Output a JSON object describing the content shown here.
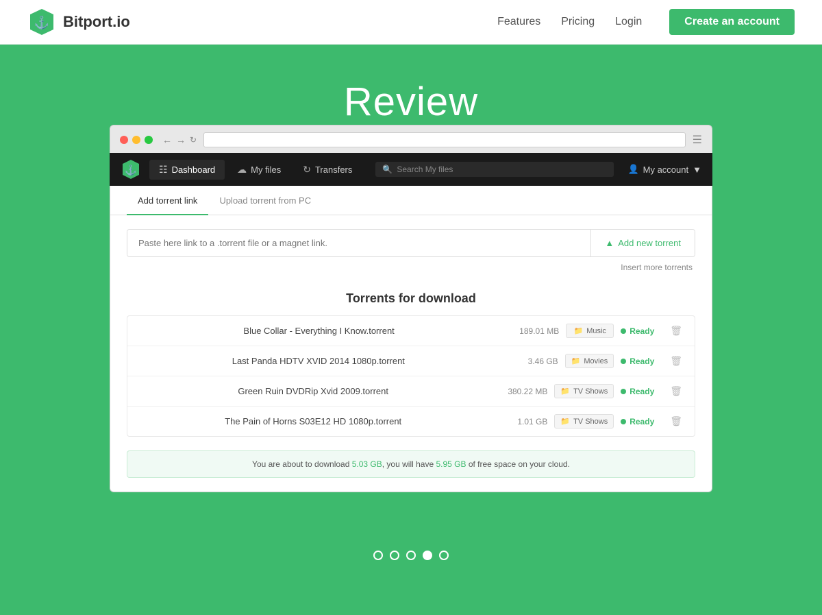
{
  "navbar": {
    "logo_text": "Bitport.io",
    "links": [
      {
        "id": "features",
        "label": "Features"
      },
      {
        "id": "pricing",
        "label": "Pricing"
      },
      {
        "id": "login",
        "label": "Login"
      }
    ],
    "cta_label": "Create an account"
  },
  "hero": {
    "title": "Review"
  },
  "app": {
    "nav": {
      "dashboard_label": "Dashboard",
      "myfiles_label": "My files",
      "transfers_label": "Transfers",
      "search_placeholder": "Search My files",
      "account_label": "My account"
    },
    "tabs": [
      {
        "id": "add-link",
        "label": "Add torrent link",
        "active": true
      },
      {
        "id": "upload-pc",
        "label": "Upload torrent from PC",
        "active": false
      }
    ],
    "input": {
      "placeholder": "Paste here link to a .torrent file or a magnet link.",
      "add_btn_label": "Add new torrent",
      "insert_more_label": "Insert more torrents"
    },
    "torrents_section": {
      "title": "Torrents for download",
      "rows": [
        {
          "name": "Blue Collar - Everything I Know.torrent",
          "size": "189.01 MB",
          "tag": "Music",
          "status": "Ready"
        },
        {
          "name": "Last Panda HDTV XVID 2014 1080p.torrent",
          "size": "3.46 GB",
          "tag": "Movies",
          "status": "Ready"
        },
        {
          "name": "Green Ruin DVDRip Xvid 2009.torrent",
          "size": "380.22 MB",
          "tag": "TV Shows",
          "status": "Ready"
        },
        {
          "name": "The Pain of Horns S03E12 HD 1080p.torrent",
          "size": "1.01 GB",
          "tag": "TV Shows",
          "status": "Ready"
        }
      ]
    },
    "download_info": {
      "pre": "You are about to download ",
      "total_size": "5.03 GB",
      "mid": ", you will have ",
      "free_space": "5.95 GB",
      "post": " of free space on your cloud."
    }
  },
  "pagination": {
    "total": 5,
    "active_index": 3
  },
  "colors": {
    "green": "#3dba6d",
    "dark_nav": "#1a1a1a"
  }
}
